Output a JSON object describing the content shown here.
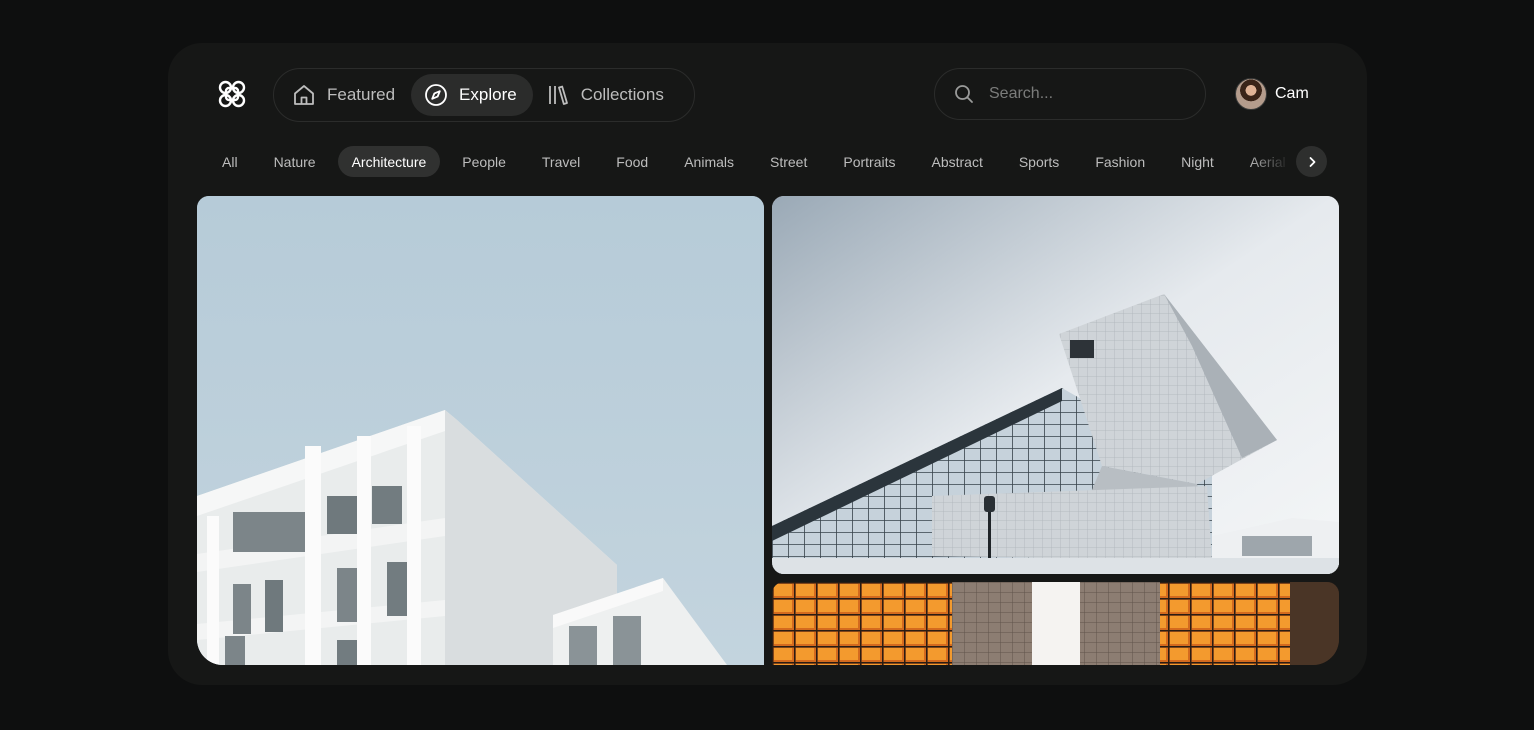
{
  "nav": {
    "items": [
      {
        "label": "Featured",
        "icon": "home-icon",
        "active": false
      },
      {
        "label": "Explore",
        "icon": "compass-icon",
        "active": true
      },
      {
        "label": "Collections",
        "icon": "library-icon",
        "active": false
      }
    ]
  },
  "search": {
    "placeholder": "Search..."
  },
  "user": {
    "name": "Cam"
  },
  "categories": {
    "items": [
      "All",
      "Nature",
      "Architecture",
      "People",
      "Travel",
      "Food",
      "Animals",
      "Street",
      "Portraits",
      "Abstract",
      "Sports",
      "Fashion",
      "Night",
      "Aerial"
    ],
    "active": "Architecture"
  },
  "colors": {
    "background": "#0e0f0f",
    "card": "#161716",
    "active_pill": "#2b2c2b",
    "text": "#ffffff",
    "muted_text": "#bdbdbd"
  },
  "icons": {
    "logo": "flower-logo-icon",
    "search": "search-icon",
    "next": "chevron-right-icon"
  }
}
